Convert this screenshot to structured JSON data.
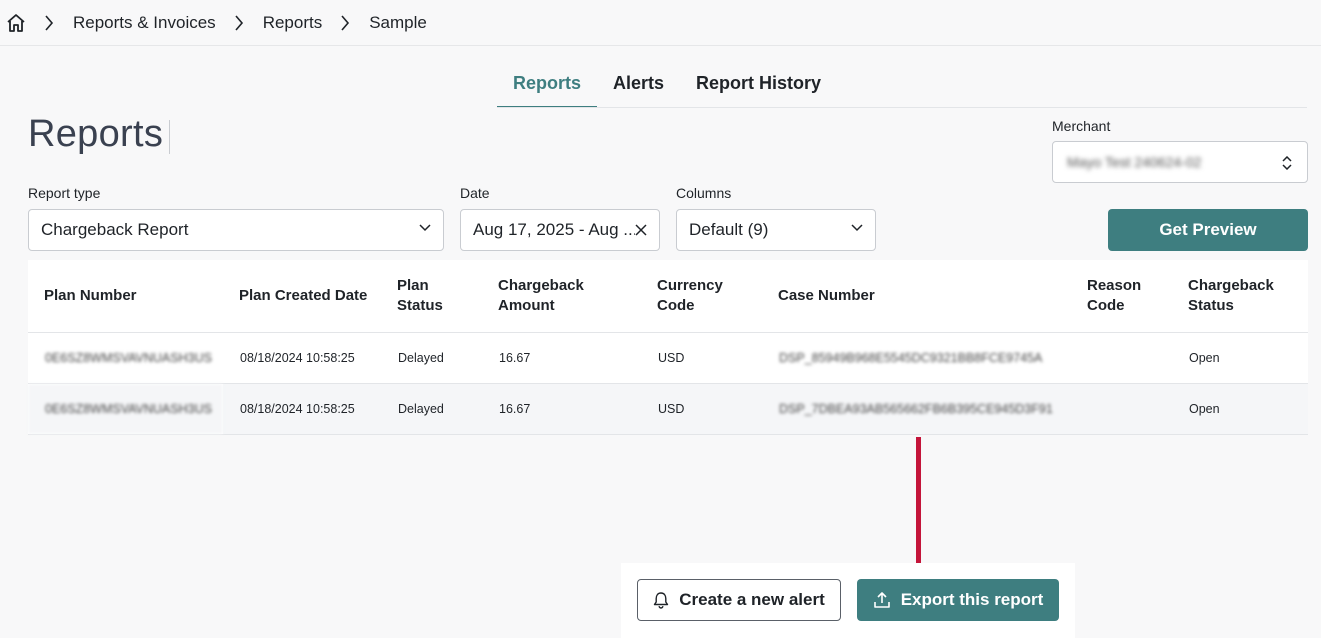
{
  "breadcrumb": {
    "home_icon": "home-icon",
    "items": [
      "Reports & Invoices",
      "Reports"
    ],
    "current": "Sample"
  },
  "tabs": [
    {
      "label": "Reports",
      "active": true
    },
    {
      "label": "Alerts",
      "active": false
    },
    {
      "label": "Report History",
      "active": false
    }
  ],
  "page_title": "Reports",
  "merchant": {
    "label": "Merchant",
    "value": "Mayo Test 240624-02"
  },
  "filters": {
    "report_type_label": "Report type",
    "report_type_value": "Chargeback Report",
    "date_label": "Date",
    "date_value": "Aug 17, 2025 - Aug ...",
    "columns_label": "Columns",
    "columns_value": "Default (9)"
  },
  "get_preview_label": "Get Preview",
  "table": {
    "columns": [
      "Plan Number",
      "Plan Created Date",
      "Plan Status",
      "Chargeback Amount",
      "Currency Code",
      "Case Number",
      "Reason Code",
      "Chargeback Status"
    ],
    "rows": [
      [
        "0E6SZ8WMSVAVNUASH3US",
        "08/18/2024 10:58:25",
        "Delayed",
        "16.67",
        "USD",
        "DSP_85949B968E5545DC9321BB8FCE9745A",
        "",
        "Open"
      ],
      [
        "0E6SZ8WMSVAVNUASH3US",
        "08/18/2024 10:58:25",
        "Delayed",
        "16.67",
        "USD",
        "DSP_7DBEA93AB565662FB6B395CE945D3F91",
        "",
        "Open"
      ]
    ]
  },
  "actions": {
    "create_alert_label": "Create a new alert",
    "export_label": "Export this report"
  },
  "colors": {
    "accent": "#3e7e80",
    "annotation_arrow": "#c4143a"
  }
}
